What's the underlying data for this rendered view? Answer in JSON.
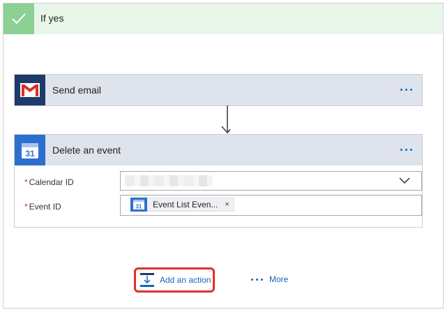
{
  "branch": {
    "title": "If yes",
    "check_icon": "checkmark-icon",
    "accent": "#8cd094"
  },
  "send_email": {
    "title": "Send email",
    "icon": "gmail-icon",
    "more_icon": "ellipsis-icon"
  },
  "delete_event": {
    "title": "Delete an event",
    "icon": "google-calendar-icon",
    "icon_text": "31",
    "more_icon": "ellipsis-icon",
    "fields": {
      "calendar_id": {
        "label": "Calendar ID",
        "required_mark": "*",
        "value_hidden": true,
        "dropdown_icon": "chevron-down-icon"
      },
      "event_id": {
        "label": "Event ID",
        "required_mark": "*",
        "token": {
          "icon_text": "31",
          "label": "Event List Even...",
          "remove": "×"
        }
      }
    }
  },
  "footer": {
    "add_action_label": "Add an action",
    "more_label": "More",
    "link_color": "#1565b8",
    "highlight_color": "#e03128"
  }
}
